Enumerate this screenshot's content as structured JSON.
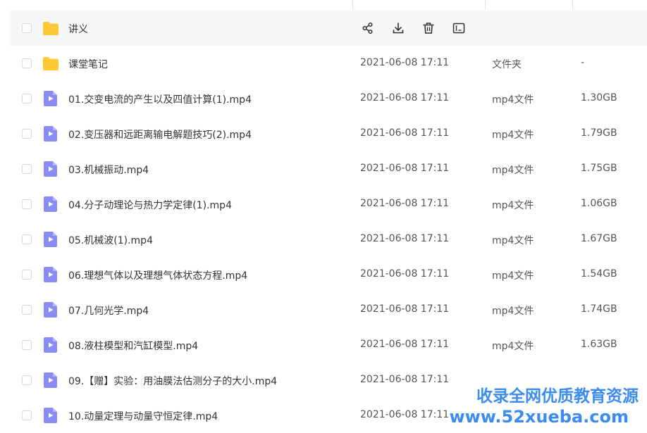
{
  "rows": [
    {
      "kind": "folder",
      "name": "讲义",
      "time": "",
      "type": "",
      "size": "",
      "hover": true
    },
    {
      "kind": "folder",
      "name": "课堂笔记",
      "time": "2021-06-08 17:11",
      "type": "文件夹",
      "size": "-"
    },
    {
      "kind": "video",
      "name": "01.交变电流的产生以及四值计算(1).mp4",
      "time": "2021-06-08 17:11",
      "type": "mp4文件",
      "size": "1.30GB"
    },
    {
      "kind": "video",
      "name": "02.变压器和远距离输电解题技巧(2).mp4",
      "time": "2021-06-08 17:11",
      "type": "mp4文件",
      "size": "1.79GB"
    },
    {
      "kind": "video",
      "name": "03.机械振动.mp4",
      "time": "2021-06-08 17:11",
      "type": "mp4文件",
      "size": "1.75GB"
    },
    {
      "kind": "video",
      "name": "04.分子动理论与热力学定律(1).mp4",
      "time": "2021-06-08 17:11",
      "type": "mp4文件",
      "size": "1.06GB"
    },
    {
      "kind": "video",
      "name": "05.机械波(1).mp4",
      "time": "2021-06-08 17:11",
      "type": "mp4文件",
      "size": "1.67GB"
    },
    {
      "kind": "video",
      "name": "06.理想气体以及理想气体状态方程.mp4",
      "time": "2021-06-08 17:11",
      "type": "mp4文件",
      "size": "1.54GB"
    },
    {
      "kind": "video",
      "name": "07.几何光学.mp4",
      "time": "2021-06-08 17:11",
      "type": "mp4文件",
      "size": "1.74GB"
    },
    {
      "kind": "video",
      "name": "08.液柱模型和汽缸模型.mp4",
      "time": "2021-06-08 17:11",
      "type": "mp4文件",
      "size": "1.63GB"
    },
    {
      "kind": "video",
      "name": "09.【赠】实验：用油膜法估测分子的大小.mp4",
      "time": "2021-06-08 17:11",
      "type": "",
      "size": ""
    },
    {
      "kind": "video",
      "name": "10.动量定理与动量守恒定律.mp4",
      "time": "2021-06-08 17:11",
      "type": "",
      "size": ""
    }
  ],
  "row_actions": [
    "share-icon",
    "download-icon",
    "delete-icon",
    "rename-icon"
  ],
  "watermark": {
    "line1": "收录全网优质教育资源",
    "line2": "www.52xueba.com"
  },
  "colors": {
    "folder": "#ffc933",
    "video": "#8a8cf6",
    "watermark": "#3c8cf0",
    "hover": "#f6f7f9"
  }
}
